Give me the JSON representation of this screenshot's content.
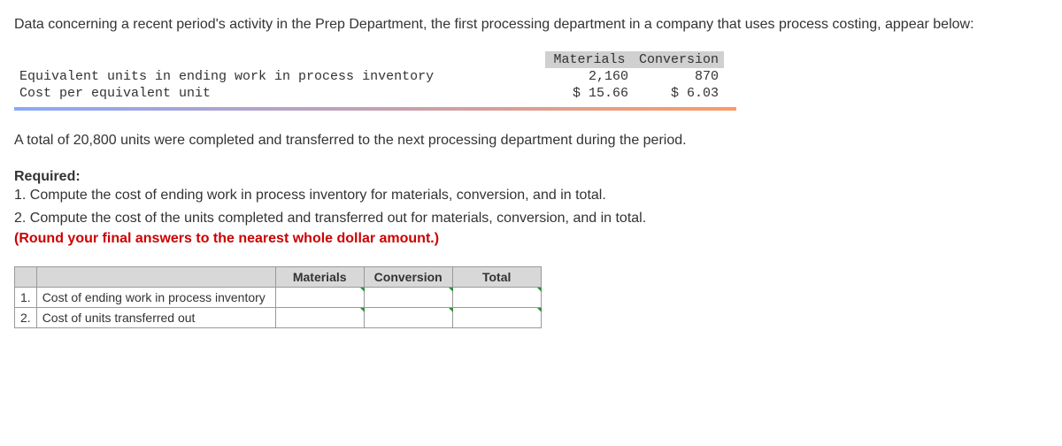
{
  "intro": "Data concerning a recent period's activity in the Prep Department, the first processing department in a company that uses process costing, appear below:",
  "data_table": {
    "headers": {
      "materials": "Materials",
      "conversion": "Conversion"
    },
    "rows": [
      {
        "label": "Equivalent units in ending work in process inventory",
        "materials": "2,160",
        "conversion": "870"
      },
      {
        "label": "Cost per equivalent unit",
        "materials": "$ 15.66",
        "conversion": "$ 6.03"
      }
    ]
  },
  "middle": "A total of 20,800 units were completed and transferred to the next processing department during the period.",
  "required_label": "Required:",
  "req1": "1. Compute the cost of ending work in process inventory for materials, conversion, and in total.",
  "req2": "2. Compute the cost of the units completed and transferred out for materials, conversion, and in total.",
  "round_note": "(Round your final answers to the nearest whole dollar amount.)",
  "answer_table": {
    "headers": {
      "materials": "Materials",
      "conversion": "Conversion",
      "total": "Total"
    },
    "rows": [
      {
        "num": "1.",
        "label": "Cost of ending work in process inventory"
      },
      {
        "num": "2.",
        "label": "Cost of units transferred out"
      }
    ]
  }
}
